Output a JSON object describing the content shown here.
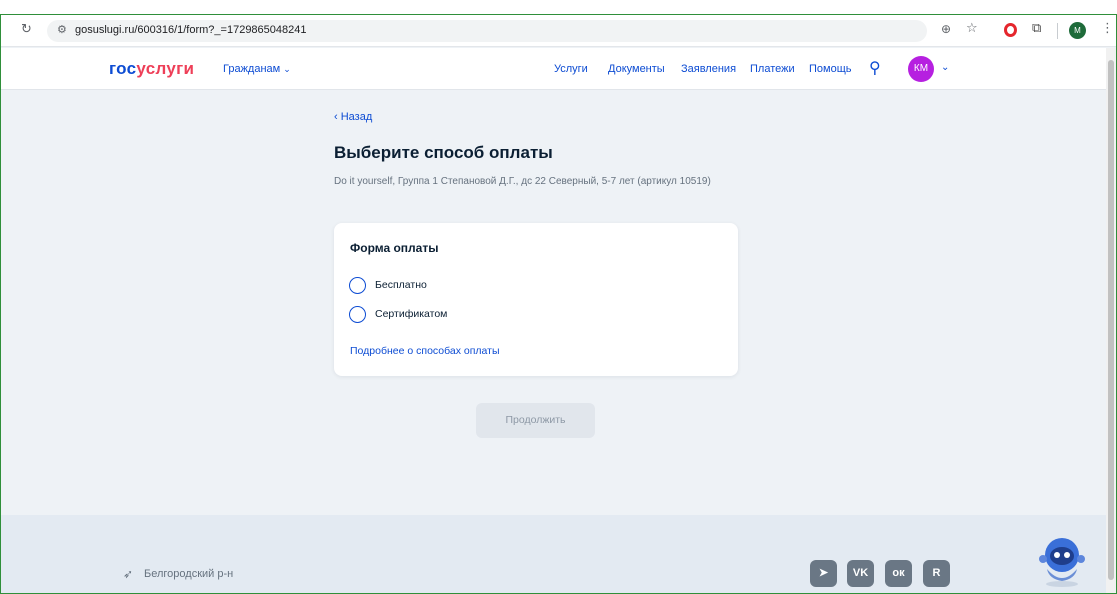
{
  "browser": {
    "url": "gosuslugi.ru/600316/1/form?_=1729865048241",
    "profile_initial": "M"
  },
  "header": {
    "logo_part1": "гос",
    "logo_part2": "услуги",
    "audience_label": "Гражданам",
    "nav": [
      "Услуги",
      "Документы",
      "Заявления",
      "Платежи",
      "Помощь"
    ],
    "avatar_initials": "КМ"
  },
  "content": {
    "back_label": "‹ Назад",
    "title": "Выберите способ оплаты",
    "description": "Do it yourself, Группа 1 Степановой Д.Г., дс 22 Северный, 5-7 лет (артикул 10519)",
    "payment_form": {
      "title": "Форма оплаты",
      "options": [
        {
          "label": "Бесплатно",
          "selected": false
        },
        {
          "label": "Сертификатом",
          "selected": false
        }
      ],
      "more_link": "Подробнее о способах оплаты"
    },
    "continue_label": "Продолжить"
  },
  "footer": {
    "location": "Белгородский р-н",
    "socials": [
      {
        "icon": "telegram-icon",
        "glyph": "➤"
      },
      {
        "icon": "vk-icon",
        "glyph": "VK"
      },
      {
        "icon": "ok-icon",
        "glyph": "ок"
      },
      {
        "icon": "rutube-icon",
        "glyph": "R"
      }
    ]
  },
  "colors": {
    "brand_blue": "#0d4cd3",
    "brand_red": "#ee3f58",
    "avatar": "#b620e0",
    "page_bg": "#eef2f6"
  }
}
